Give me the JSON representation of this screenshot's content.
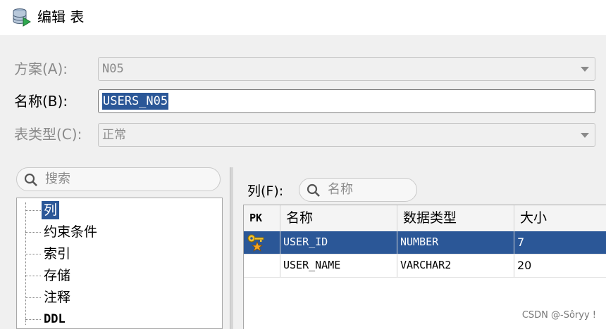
{
  "window": {
    "title": "编辑 表",
    "icon": "database-table-icon"
  },
  "form": {
    "schema": {
      "label": "方案(A):",
      "value": "N05",
      "enabled": false
    },
    "name": {
      "label": "名称(B):",
      "value": "USERS_N05",
      "enabled": true
    },
    "table_type": {
      "label": "表类型(C):",
      "value": "正常",
      "enabled": false
    }
  },
  "left_panel": {
    "search_placeholder": "搜索",
    "tree_items": [
      "列",
      "约束条件",
      "索引",
      "存储",
      "注释",
      "DDL"
    ],
    "selected_index": 0
  },
  "right_panel": {
    "filter_label": "列(F):",
    "filter_placeholder": "名称",
    "columns": [
      "PK",
      "名称",
      "数据类型",
      "大小"
    ],
    "rows": [
      {
        "pk": true,
        "name": "USER_ID",
        "type": "NUMBER",
        "size": "7",
        "selected": true
      },
      {
        "pk": false,
        "name": "USER_NAME",
        "type": "VARCHAR2",
        "size": "20",
        "selected": false
      }
    ]
  },
  "watermark": "CSDN @-Sôryy !",
  "colors": {
    "selection": "#2b5797",
    "disabled_text": "#8a8a8a"
  }
}
